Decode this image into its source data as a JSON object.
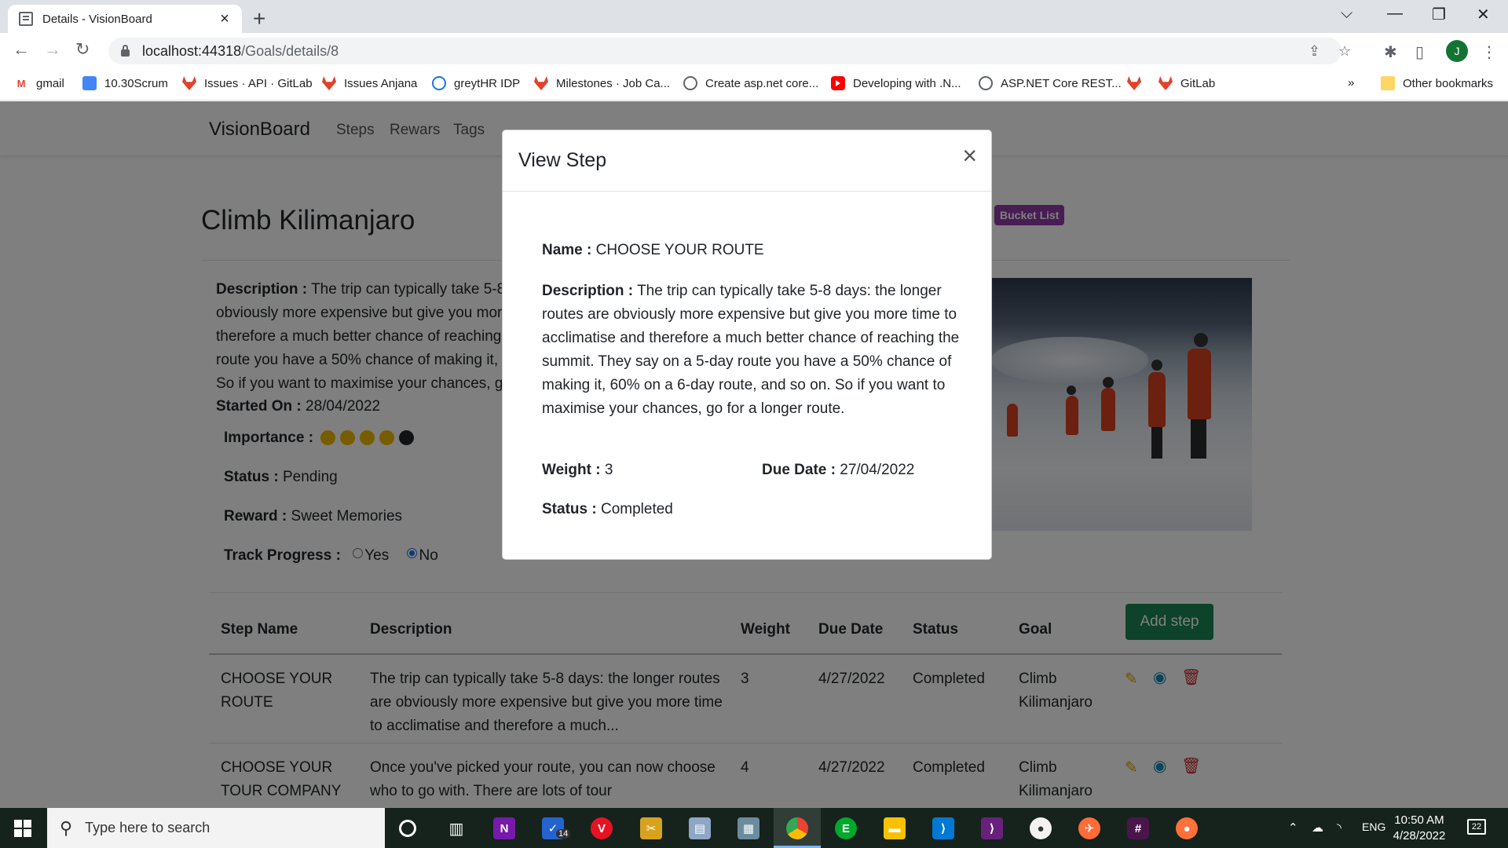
{
  "browser": {
    "tab_title": "Details - VisionBoard",
    "url_host": "localhost:44318",
    "url_path": "/Goals/details/8",
    "profile_initial": "J",
    "bookmarks": [
      "gmail",
      "10.30Scrum",
      "Issues · API · GitLab",
      "Issues Anjana",
      "greytHR IDP",
      "Milestones · Job Ca...",
      "Create asp.net core...",
      "Developing with .N...",
      "ASP.NET Core REST...",
      "",
      "GitLab"
    ],
    "other_bookmarks": "Other bookmarks",
    "overflow": "»"
  },
  "nav": {
    "brand": "VisionBoard",
    "links": [
      "Steps",
      "Rewars",
      "Tags"
    ]
  },
  "goal": {
    "title": "Climb Kilimanjaro",
    "badge": "Bucket List",
    "description_label": "Description :",
    "description": "The trip can typically take 5-8 days: the longer routes are obviously more expensive but give you more time to acclimatise and therefore a much better chance of reaching the summit. They say on a 5-day route you have a 50% chance of making it, 60% on a 6-day route, and so on. So if you want to maximise your chances, go for a longer route.",
    "started_label": "Started On :",
    "started": "28/04/2022",
    "importance_label": "Importance :",
    "importance": 4,
    "importance_max": 5,
    "status_label": "Status :",
    "status": "Pending",
    "reward_label": "Reward :",
    "reward": "Sweet Memories",
    "track_label": "Track Progress :",
    "track_yes": "Yes",
    "track_no": "No",
    "track_selected": "No"
  },
  "steps_table": {
    "add_button": "Add step",
    "headers": [
      "Step Name",
      "Description",
      "Weight",
      "Due Date",
      "Status",
      "Goal"
    ],
    "rows": [
      {
        "name": "CHOOSE YOUR ROUTE",
        "description": "The trip can typically take 5-8 days: the longer routes are obviously more expensive but give you more time to acclimatise and therefore a much...",
        "weight": "3",
        "due": "4/27/2022",
        "status": "Completed",
        "goal": "Climb Kilimanjaro"
      },
      {
        "name": "CHOOSE YOUR TOUR COMPANY",
        "description": "Once you've picked your route, you can now choose who to go with. There are lots of tour",
        "weight": "4",
        "due": "4/27/2022",
        "status": "Completed",
        "goal": "Climb Kilimanjaro"
      }
    ]
  },
  "modal": {
    "title": "View Step",
    "close": "×",
    "name_label": "Name :",
    "name": "CHOOSE YOUR ROUTE",
    "description_label": "Description :",
    "description": "The trip can typically take 5-8 days: the longer routes are obviously more expensive but give you more time to acclimatise and therefore a much better chance of reaching the summit. They say on a 5-day route you have a 50% chance of making it, 60% on a 6-day route, and so on. So if you want to maximise your chances, go for a longer route.",
    "weight_label": "Weight :",
    "weight": "3",
    "due_label": "Due Date :",
    "due": "27/04/2022",
    "status_label": "Status :",
    "status": "Completed"
  },
  "taskbar": {
    "search_placeholder": "Type here to search",
    "todo_badge": "14",
    "lang": "ENG",
    "time": "10:50 AM",
    "date": "4/28/2022",
    "notifications": "22"
  },
  "colors": {
    "accent_green": "#198754",
    "badge_purple": "#8e3aa6",
    "importance_on": "#f0b800",
    "importance_off": "#212529"
  }
}
